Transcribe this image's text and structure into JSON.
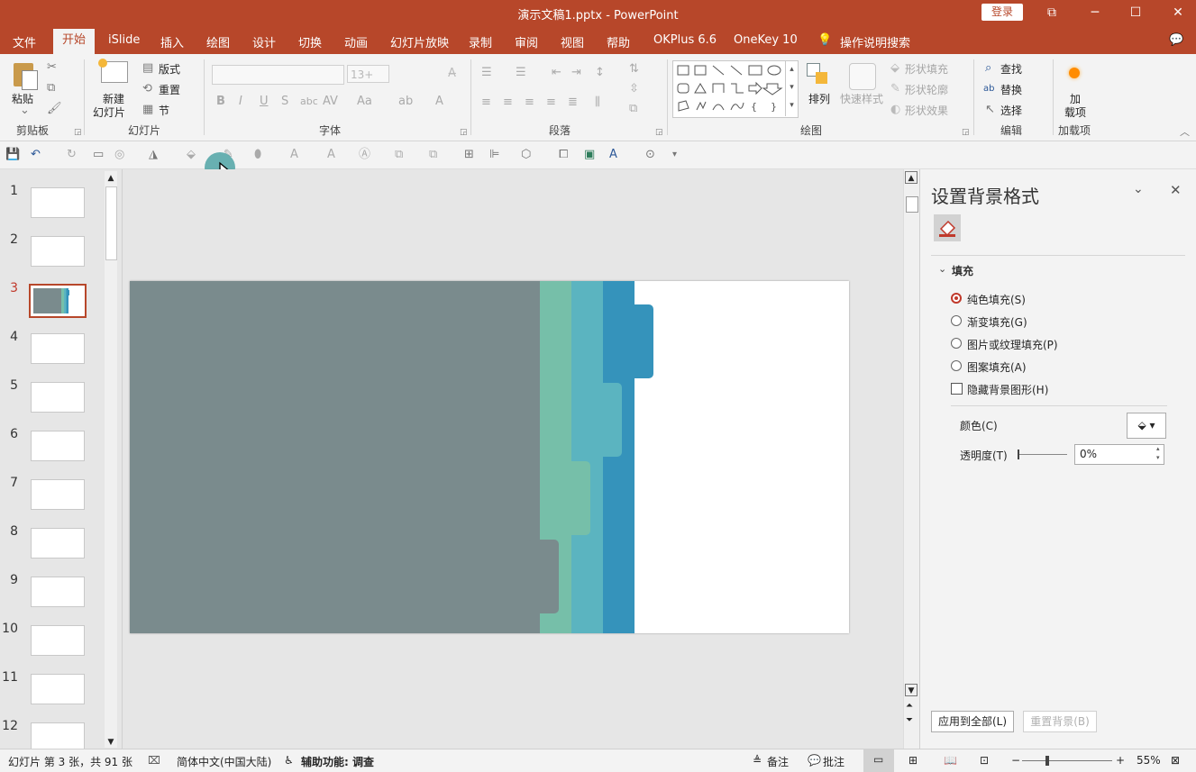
{
  "window": {
    "title": "演示文稿1.pptx  -  PowerPoint",
    "login_label": "登录",
    "controls": [
      "⧉",
      "─",
      "☐",
      "✕"
    ]
  },
  "tabs": [
    "文件",
    "开始",
    "iSlide",
    "插入",
    "绘图",
    "设计",
    "切换",
    "动画",
    "幻灯片放映",
    "录制",
    "审阅",
    "视图",
    "帮助",
    "OKPlus 6.6",
    "OneKey 10"
  ],
  "active_tab": "开始",
  "tell_me": "操作说明搜索",
  "ribbon": {
    "clipboard": {
      "paste": "粘贴",
      "label": "剪贴板"
    },
    "slides": {
      "new_slide_line1": "新建",
      "new_slide_line2": "幻灯片",
      "layout": "版式",
      "reset": "重置",
      "section": "节",
      "label": "幻灯片"
    },
    "font": {
      "size_value": "13+",
      "label": "字体"
    },
    "paragraph": {
      "label": "段落"
    },
    "drawing": {
      "arrange": "排列",
      "quick_styles": "快速样式",
      "shape_fill": "形状填充",
      "shape_outline": "形状轮廓",
      "shape_effects": "形状效果",
      "label": "绘图"
    },
    "editing": {
      "find": "查找",
      "replace": "替换",
      "select": "选择",
      "label": "编辑"
    },
    "addins": {
      "load_line1": "加",
      "load_line2": "载项",
      "label": "加载项"
    }
  },
  "thumbnails": {
    "numbers": [
      "1",
      "2",
      "3",
      "4",
      "5",
      "6",
      "7",
      "8",
      "9",
      "10",
      "11",
      "12"
    ],
    "selected": "3"
  },
  "slide_colors": {
    "gray": "#7a8b8d",
    "mint": "#76bfa9",
    "teal": "#5bb4c0",
    "blue": "#3593bb",
    "white": "#ffffff"
  },
  "format_pane": {
    "title": "设置背景格式",
    "section": "填充",
    "options": [
      "纯色填充(S)",
      "渐变填充(G)",
      "图片或纹理填充(P)",
      "图案填充(A)"
    ],
    "selected_option": "纯色填充(S)",
    "hide_bg_graphics": "隐藏背景图形(H)",
    "color_label": "颜色(C)",
    "transparency_label": "透明度(T)",
    "transparency_value": "0%",
    "apply_all": "应用到全部(L)",
    "reset_bg": "重置背景(B)"
  },
  "status": {
    "slide_info": "幻灯片 第 3 张，共 91 张",
    "language": "简体中文(中国大陆)",
    "accessibility": "辅助功能: 调查",
    "notes": "备注",
    "comments": "批注",
    "zoom": "55%"
  }
}
